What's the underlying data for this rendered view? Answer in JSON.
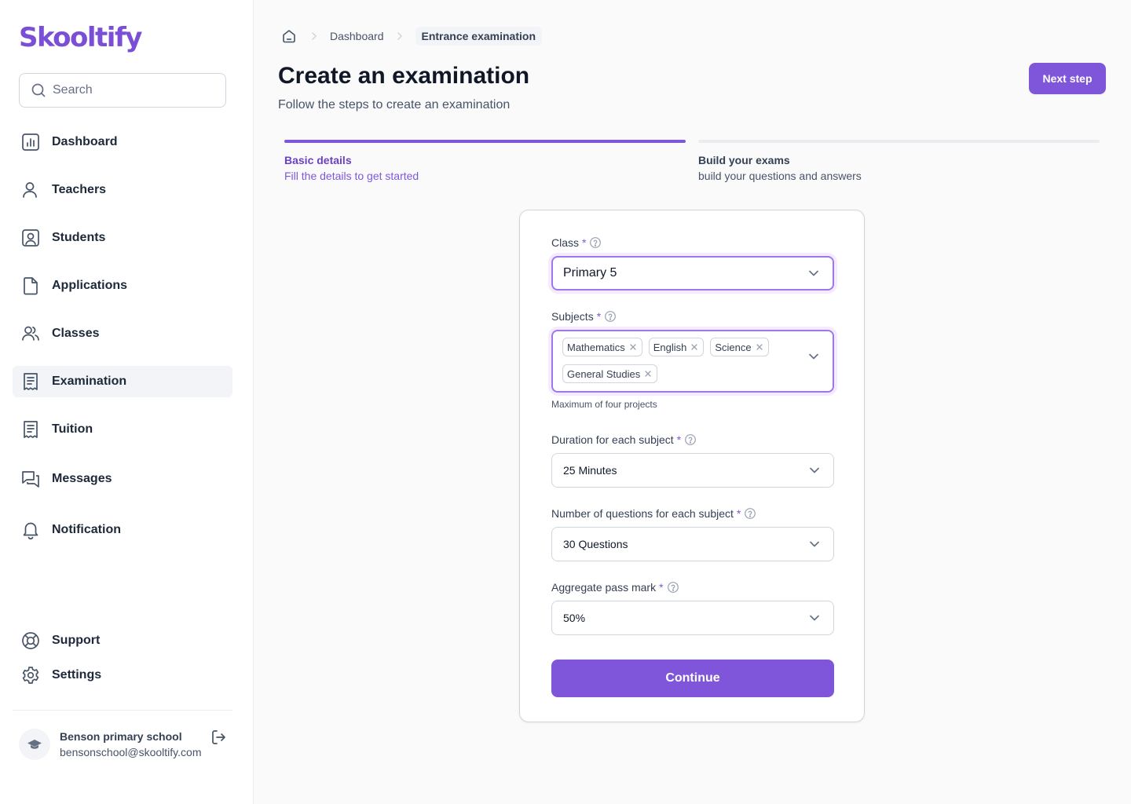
{
  "app": {
    "logo_text": "Skooltify",
    "brand_color": "#7f56d9"
  },
  "sidebar": {
    "search_placeholder": "Search",
    "items": [
      {
        "label": "Dashboard",
        "icon": "chart-icon"
      },
      {
        "label": "Teachers",
        "icon": "user-icon"
      },
      {
        "label": "Students",
        "icon": "user-square-icon"
      },
      {
        "label": "Applications",
        "icon": "file-icon"
      },
      {
        "label": "Classes",
        "icon": "users-icon"
      },
      {
        "label": "Examination",
        "icon": "receipt-icon",
        "active": true
      },
      {
        "label": "Tuition",
        "icon": "receipt-icon"
      },
      {
        "label": "Messages",
        "icon": "messages-icon"
      },
      {
        "label": "Notification",
        "icon": "bell-icon"
      }
    ],
    "footer_items": [
      {
        "label": "Support",
        "icon": "life-buoy-icon"
      },
      {
        "label": "Settings",
        "icon": "gear-icon"
      }
    ],
    "account": {
      "name": "Benson primary school",
      "email": "bensonschool@skooltify.com",
      "avatar_icon": "graduation-cap-icon",
      "logout_icon": "logout-icon"
    }
  },
  "breadcrumb": {
    "home_icon": "home-icon",
    "items": [
      "Dashboard",
      "Entrance examination"
    ]
  },
  "header": {
    "title": "Create an examination",
    "subtitle": "Follow the steps to create an examination",
    "next_label": "Next step"
  },
  "steps": [
    {
      "title": "Basic details",
      "description": "Fill the details to get started",
      "active": true
    },
    {
      "title": "Build your exams",
      "description": "build your questions and answers",
      "active": false
    }
  ],
  "form": {
    "class": {
      "label": "Class",
      "required_mark": "*",
      "value": "Primary 5"
    },
    "subjects": {
      "label": "Subjects",
      "required_mark": "*",
      "tags": [
        "Mathematics",
        "English",
        "Science",
        "General Studies"
      ],
      "hint": "Maximum of four projects"
    },
    "duration": {
      "label": "Duration for each subject",
      "required_mark": "*",
      "value": "25 Minutes"
    },
    "questions": {
      "label": "Number of questions for each subject",
      "required_mark": "*",
      "value": "30 Questions"
    },
    "pass_mark": {
      "label": "Aggregate pass mark",
      "required_mark": "*",
      "value": "50%"
    },
    "submit_label": "Continue"
  }
}
